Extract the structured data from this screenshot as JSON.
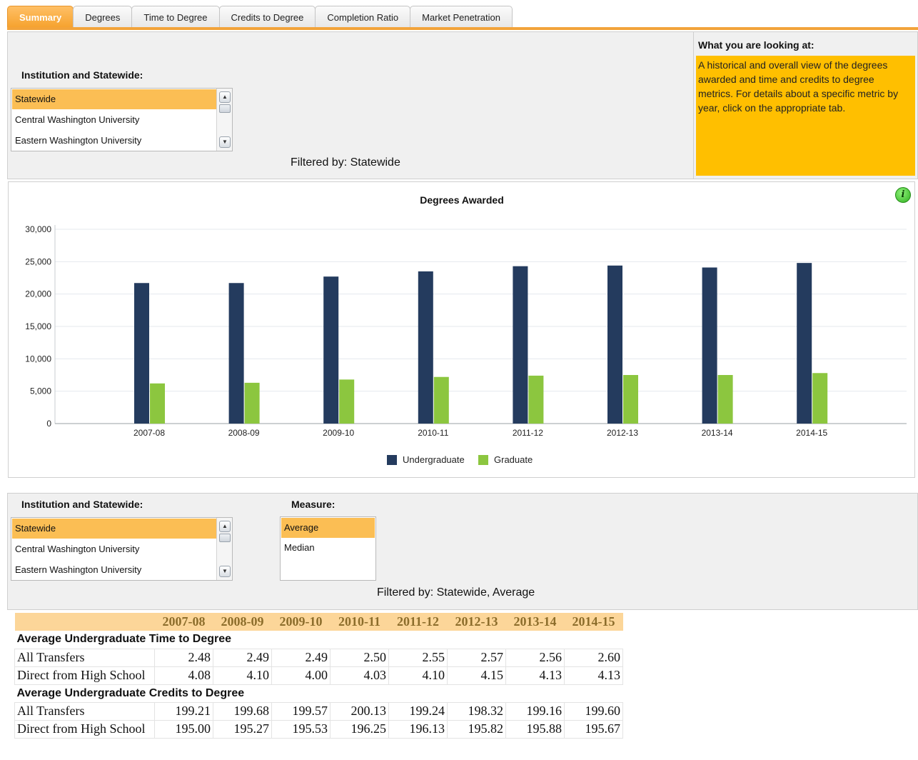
{
  "tabs": [
    "Summary",
    "Degrees",
    "Time to Degree",
    "Credits to Degree",
    "Completion Ratio",
    "Market Penetration"
  ],
  "top_panel": {
    "label": "Institution and Statewide:",
    "list": [
      "Statewide",
      "Central Washington University",
      "Eastern Washington University"
    ],
    "selected": "Statewide",
    "filter_text": "Filtered by: Statewide"
  },
  "info": {
    "title": "What you are looking at:",
    "text": "A historical and overall view of the degrees awarded and time and credits to degree metrics.  For details about a specific metric by year, click on the appropriate tab.",
    "icon": "info-icon",
    "icon_glyph": "i"
  },
  "scroll": {
    "up": "▲",
    "down": "▼"
  },
  "chart_data": {
    "type": "bar",
    "title": "Degrees Awarded",
    "categories": [
      "2007-08",
      "2008-09",
      "2009-10",
      "2010-11",
      "2011-12",
      "2012-13",
      "2013-14",
      "2014-15"
    ],
    "series": [
      {
        "name": "Undergraduate",
        "color": "#243b5e",
        "values": [
          21700,
          21700,
          22700,
          23500,
          24300,
          24400,
          24100,
          24800
        ]
      },
      {
        "name": "Graduate",
        "color": "#8cc63f",
        "values": [
          6200,
          6300,
          6800,
          7200,
          7400,
          7500,
          7500,
          7800
        ]
      }
    ],
    "yticks": [
      "0",
      "5,000",
      "10,000",
      "15,000",
      "20,000",
      "25,000",
      "30,000"
    ],
    "ylim": [
      0,
      30000
    ],
    "grid": true,
    "legend": "bottom"
  },
  "bottom_panel": {
    "institution_label": "Institution and Statewide:",
    "institution_list": [
      "Statewide",
      "Central Washington University",
      "Eastern Washington University"
    ],
    "measure_label": "Measure:",
    "measure_list": [
      "Average",
      "Median"
    ],
    "filter_text": "Filtered by: Statewide, Average"
  },
  "table": {
    "years": [
      "2007-08",
      "2008-09",
      "2009-10",
      "2010-11",
      "2011-12",
      "2012-13",
      "2013-14",
      "2014-15"
    ],
    "sections": [
      {
        "title": "Average Undergraduate Time to Degree",
        "rows": [
          {
            "label": "All Transfers",
            "values": [
              "2.48",
              "2.49",
              "2.49",
              "2.50",
              "2.55",
              "2.57",
              "2.56",
              "2.60"
            ]
          },
          {
            "label": "Direct from High School",
            "values": [
              "4.08",
              "4.10",
              "4.00",
              "4.03",
              "4.10",
              "4.15",
              "4.13",
              "4.13"
            ]
          }
        ]
      },
      {
        "title": "Average Undergraduate Credits to Degree",
        "rows": [
          {
            "label": "All Transfers",
            "values": [
              "199.21",
              "199.68",
              "199.57",
              "200.13",
              "199.24",
              "198.32",
              "199.16",
              "199.60"
            ]
          },
          {
            "label": "Direct from High School",
            "values": [
              "195.00",
              "195.27",
              "195.53",
              "196.25",
              "196.13",
              "195.82",
              "195.88",
              "195.67"
            ]
          }
        ]
      }
    ]
  }
}
